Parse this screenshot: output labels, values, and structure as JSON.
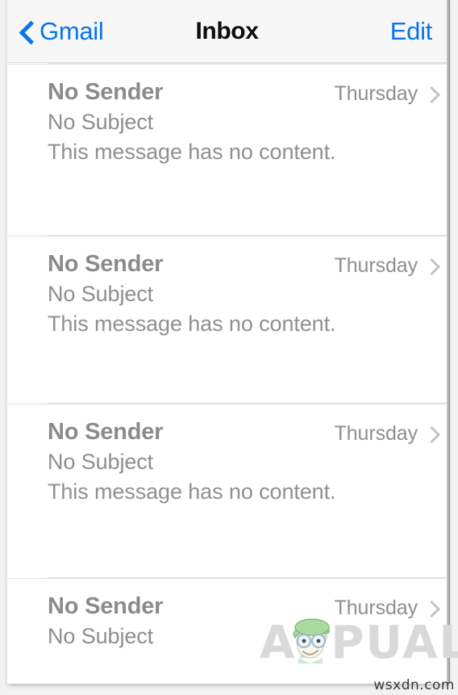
{
  "navbar": {
    "back_label": "Gmail",
    "back_icon": "chevron-left-icon",
    "title": "Inbox",
    "edit_label": "Edit"
  },
  "list": {
    "rows": [
      {
        "sender": "No Sender",
        "subject": "No Subject",
        "preview": "This message has no content.",
        "date": "Thursday",
        "disclosure_icon": "chevron-right-icon"
      },
      {
        "sender": "No Sender",
        "subject": "No Subject",
        "preview": "This message has no content.",
        "date": "Thursday",
        "disclosure_icon": "chevron-right-icon"
      },
      {
        "sender": "No Sender",
        "subject": "No Subject",
        "preview": "This message has no content.",
        "date": "Thursday",
        "disclosure_icon": "chevron-right-icon"
      },
      {
        "sender": "No Sender",
        "subject": "No Subject",
        "preview": "",
        "date": "Thursday",
        "disclosure_icon": "chevron-right-icon"
      }
    ]
  },
  "watermark": {
    "text": "APPUALS",
    "mascot_icon": "appuals-mascot-icon"
  },
  "credit": {
    "text": "wsxdn.com"
  },
  "colors": {
    "accent_blue": "#0a74e8",
    "title_black": "#0d0d0d",
    "sender_gray": "#8b8b8b",
    "body_gray": "#8e8e8e",
    "divider_gray": "#e0e0e0",
    "navbar_bg": "#f7f7f7",
    "panel_bg": "#ffffff",
    "watermark_gray": "#d9d9d9"
  }
}
